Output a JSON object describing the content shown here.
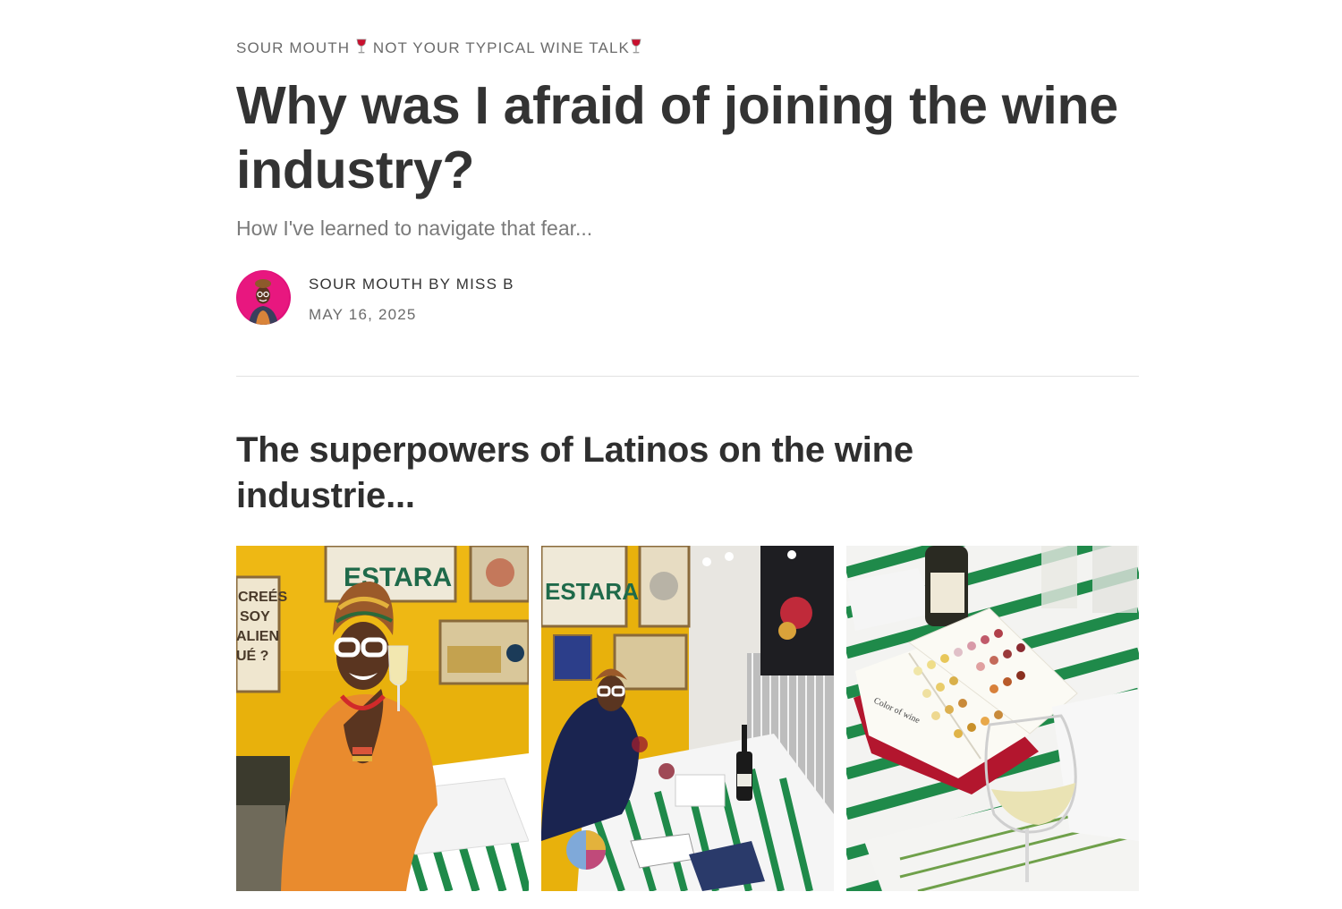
{
  "publication": {
    "prefix": "SOUR MOUTH",
    "name": "NOT YOUR TYPICAL WINE TALK",
    "icon": "wine-glass-icon"
  },
  "post": {
    "title": "Why was I afraid of joining the wine industry?",
    "subtitle": "How I've learned to navigate that fear..."
  },
  "byline": {
    "author": "SOUR MOUTH BY MISS B",
    "date": "MAY 16, 2025"
  },
  "section": {
    "heading": "The superpowers of Latinos on the wine industrie..."
  },
  "gallery": {
    "poster_text_1": "ESTARA",
    "poster_text_2": "CREÉS SOY ALIEN UÉ ?",
    "book_caption": "Color of wine"
  },
  "colors": {
    "text_primary": "#333333",
    "text_muted": "#6b6b6b",
    "wall_yellow": "#e8b10c",
    "tablecloth_green": "#1f8a4a",
    "avatar_bg": "#e0107a"
  }
}
